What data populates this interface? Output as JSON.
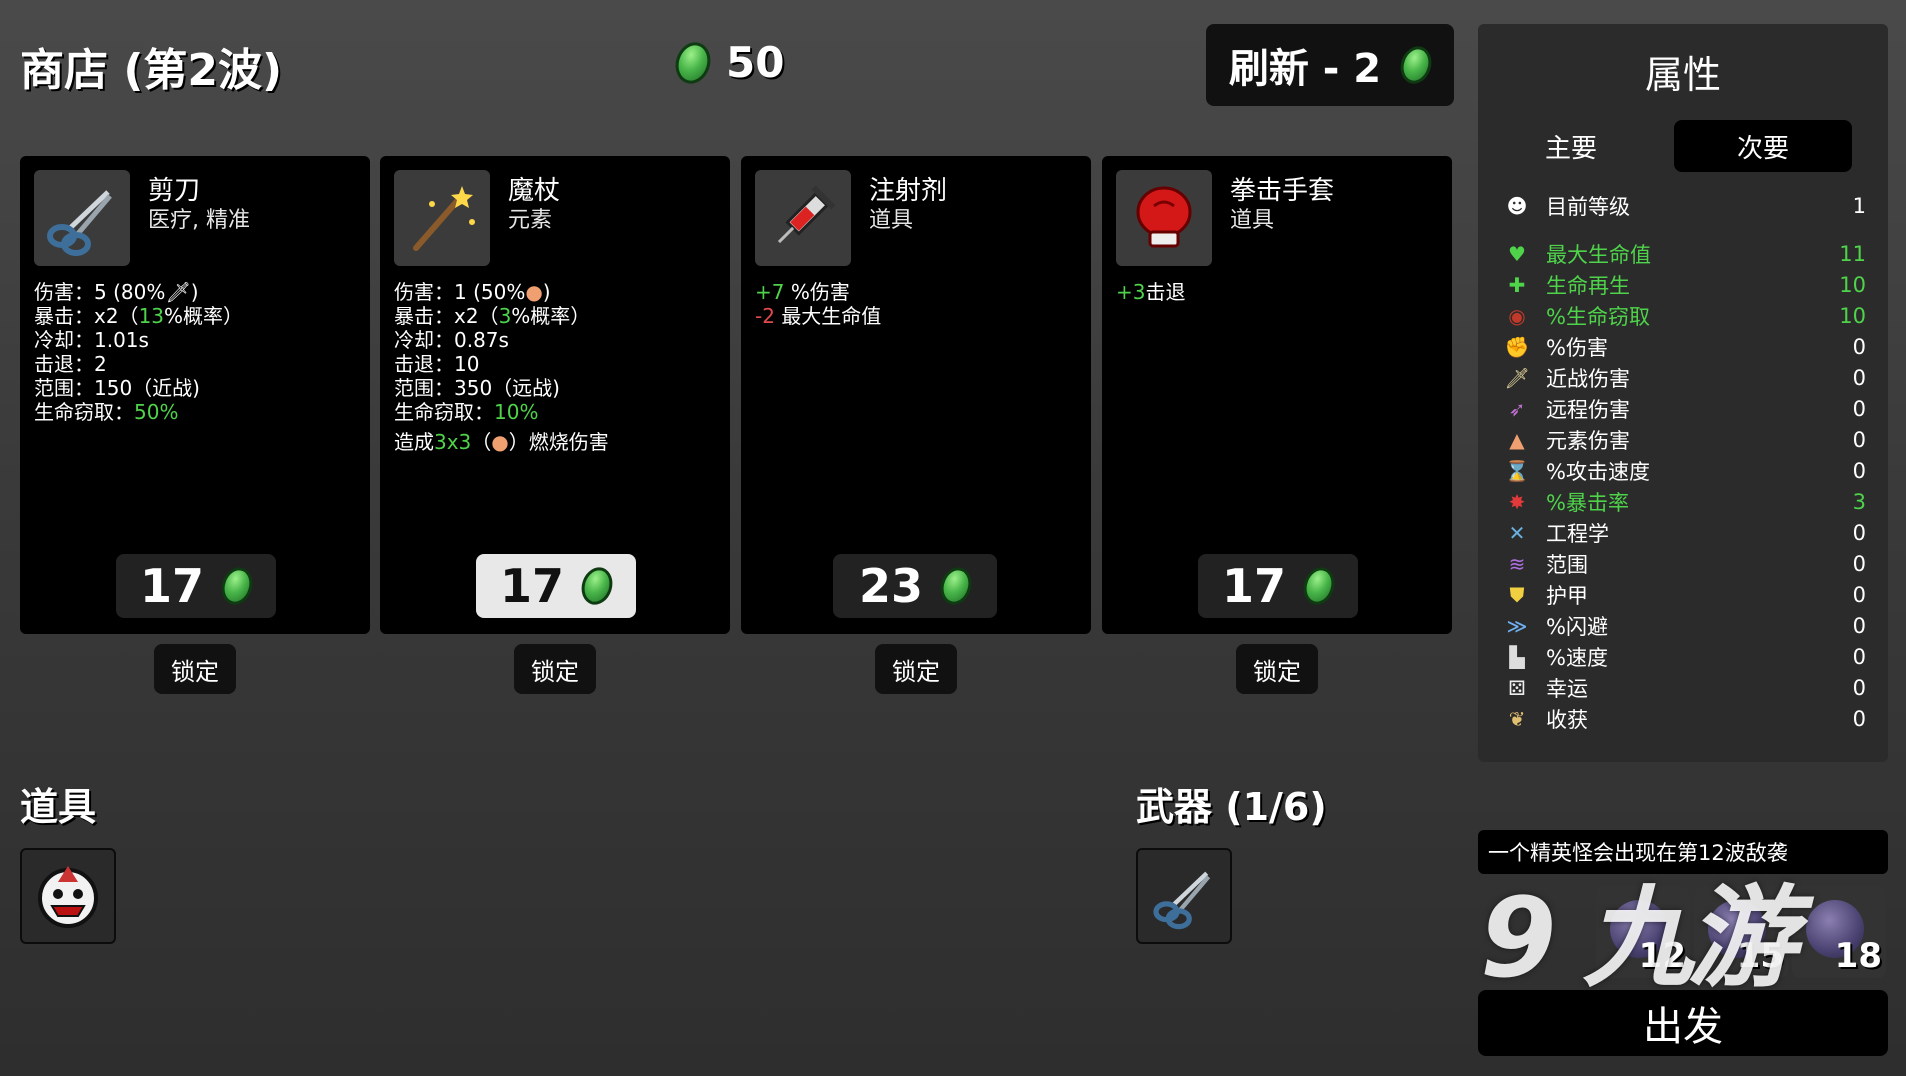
{
  "header": {
    "title": "商店 (第2波)",
    "coins": "50",
    "refresh_label": "刷新 - 2"
  },
  "colors": {
    "stat_positive": "#4ed34a",
    "stat_negative": "#e24a4a",
    "coin": "#49b64a",
    "panel": "#2b2b2b"
  },
  "shop": [
    {
      "name": "剪刀",
      "tags": "医疗, 精准",
      "icon": "scissors-icon",
      "stats": [
        {
          "pre": "伤害：5 (80%",
          "icon": "sword-icon",
          "post": ")"
        },
        {
          "pre": "暴击：x2（",
          "hl": "13",
          "post": "%概率）"
        },
        {
          "pre": "冷却：1.01s"
        },
        {
          "pre": "击退：2"
        },
        {
          "pre": "范围：150（近战)"
        },
        {
          "pre": "生命窃取：",
          "hl": "50%"
        }
      ],
      "price": "17",
      "lock_label": "锁定"
    },
    {
      "name": "魔杖",
      "tags": "元素",
      "icon": "wand-icon",
      "stats": [
        {
          "pre": "伤害：1 (50%",
          "icon": "flame-icon",
          "post": ")"
        },
        {
          "pre": "暴击：x2（",
          "hl": "3",
          "post": "%概率）"
        },
        {
          "pre": "冷却：0.87s"
        },
        {
          "pre": "击退：10"
        },
        {
          "pre": "范围：350（远战)"
        },
        {
          "pre": "生命窃取：",
          "hl": "10%"
        }
      ],
      "extra": {
        "pre": "造成",
        "hl": "3x3",
        "mid": "（",
        "post": "）燃烧伤害"
      },
      "price": "17",
      "lock_label": "锁定"
    },
    {
      "name": "注射剂",
      "tags": "道具",
      "icon": "syringe-icon",
      "effects": [
        {
          "value": "+7",
          "label": "%伤害",
          "sign": "positive"
        },
        {
          "value": "-2",
          "label": "最大生命值",
          "sign": "negative"
        }
      ],
      "price": "23",
      "lock_label": "锁定"
    },
    {
      "name": "拳击手套",
      "tags": "道具",
      "icon": "boxing-glove-icon",
      "effects": [
        {
          "value": "+3",
          "label": "击退",
          "sign": "positive"
        }
      ],
      "price": "17",
      "lock_label": "锁定"
    }
  ],
  "inventory": {
    "items_title": "道具",
    "items": [
      {
        "icon": "monster-face-icon"
      }
    ],
    "weapons_title": "武器 (1/6)",
    "weapons": [
      {
        "icon": "scissors-icon"
      }
    ]
  },
  "attributes": {
    "title": "属性",
    "tab_main": "主要",
    "tab_secondary": "次要",
    "level_label": "目前等级",
    "level_value": "1",
    "rows": [
      {
        "label": "最大生命值",
        "value": "11",
        "icon": "heart-icon",
        "highlight": true
      },
      {
        "label": "生命再生",
        "value": "10",
        "icon": "heart-plus-icon",
        "highlight": true
      },
      {
        "label": "%生命窃取",
        "value": "10",
        "icon": "fangs-icon",
        "highlight": true
      },
      {
        "label": "%伤害",
        "value": "0",
        "icon": "muscle-icon"
      },
      {
        "label": "近战伤害",
        "value": "0",
        "icon": "sword-icon"
      },
      {
        "label": "远程伤害",
        "value": "0",
        "icon": "bow-icon"
      },
      {
        "label": "元素伤害",
        "value": "0",
        "icon": "flame-icon"
      },
      {
        "label": "%攻击速度",
        "value": "0",
        "icon": "hourglass-icon"
      },
      {
        "label": "%暴击率",
        "value": "3",
        "icon": "crit-icon",
        "highlight": true
      },
      {
        "label": "工程学",
        "value": "0",
        "icon": "wrench-icon"
      },
      {
        "label": "范围",
        "value": "0",
        "icon": "range-icon"
      },
      {
        "label": "护甲",
        "value": "0",
        "icon": "shield-icon"
      },
      {
        "label": "%闪避",
        "value": "0",
        "icon": "dodge-icon"
      },
      {
        "label": "%速度",
        "value": "0",
        "icon": "boot-icon"
      },
      {
        "label": "幸运",
        "value": "0",
        "icon": "dice-icon"
      },
      {
        "label": "收获",
        "value": "0",
        "icon": "harvest-icon"
      }
    ]
  },
  "waves": {
    "note": "一个精英怪会出现在第12波敌袭",
    "elites": [
      "12",
      "15",
      "18"
    ],
    "go_label": "出发"
  },
  "watermark": "9 九游"
}
